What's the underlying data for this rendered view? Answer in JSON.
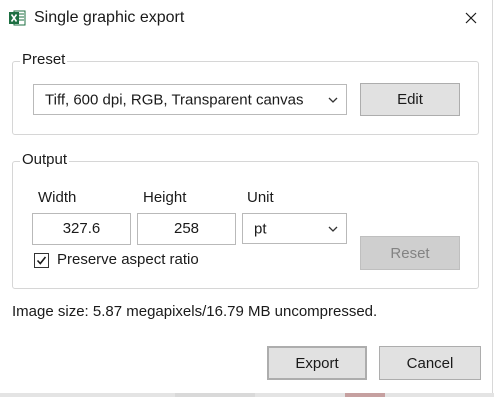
{
  "window": {
    "title": "Single graphic export",
    "app_icon": "excel-icon",
    "close_icon": "close-icon"
  },
  "preset": {
    "group_label": "Preset",
    "selected": "Tiff, 600 dpi, RGB, Transparent canvas",
    "edit_label": "Edit"
  },
  "output": {
    "group_label": "Output",
    "width_label": "Width",
    "height_label": "Height",
    "unit_label": "Unit",
    "width_value": "327.6",
    "height_value": "258",
    "unit_selected": "pt",
    "preserve_aspect_label": "Preserve aspect ratio",
    "preserve_aspect_checked": true,
    "reset_label": "Reset"
  },
  "info": {
    "image_size_text": "Image size: 5.87 megapixels/16.79 MB uncompressed."
  },
  "footer": {
    "export_label": "Export",
    "cancel_label": "Cancel"
  },
  "colors": {
    "accent": "#0078d7",
    "excel_green": "#1d6f42"
  }
}
